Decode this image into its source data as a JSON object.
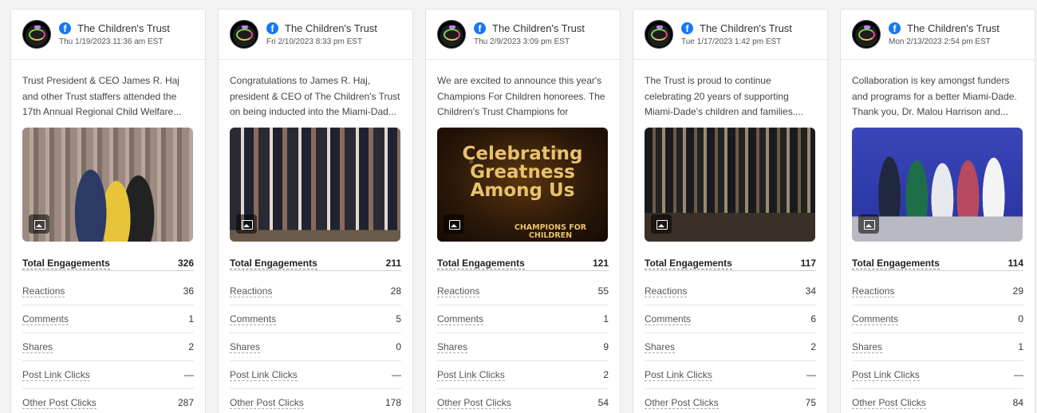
{
  "stat_labels": {
    "total": "Total Engagements",
    "reactions": "Reactions",
    "comments": "Comments",
    "shares": "Shares",
    "link_clicks": "Post Link Clicks",
    "other_clicks": "Other Post Clicks"
  },
  "posts": [
    {
      "account": "The Children's Trust",
      "network_icon": "facebook-icon",
      "date": "Thu 1/19/2023 11:36 am EST",
      "text": "Trust President & CEO James R. Haj and other Trust staffers attended the 17th Annual Regional Child Welfare...",
      "total": "326",
      "reactions": "36",
      "comments": "1",
      "shares": "2",
      "link_clicks": "—",
      "other_clicks": "287"
    },
    {
      "account": "The Children's Trust",
      "network_icon": "facebook-icon",
      "date": "Fri 2/10/2023 8:33 pm EST",
      "text": "Congratulations to James R. Haj, president & CEO of The Children's Trust on being inducted into the Miami-Dad...",
      "total": "211",
      "reactions": "28",
      "comments": "5",
      "shares": "0",
      "link_clicks": "—",
      "other_clicks": "178"
    },
    {
      "account": "The Children's Trust",
      "network_icon": "facebook-icon",
      "date": "Thu 2/9/2023 3:09 pm EST",
      "text": "We are excited to announce this year's Champions For Children honorees. The Children's Trust Champions for Childre...",
      "image_text": "Celebrating Greatness Among Us",
      "image_sub": "CHAMPIONS FOR CHILDREN",
      "total": "121",
      "reactions": "55",
      "comments": "1",
      "shares": "9",
      "link_clicks": "2",
      "other_clicks": "54"
    },
    {
      "account": "The Children's Trust",
      "network_icon": "facebook-icon",
      "date": "Tue 1/17/2023 1:42 pm EST",
      "text": "The Trust is proud to continue celebrating 20 years of supporting Miami-Dade's children and families....",
      "total": "117",
      "reactions": "34",
      "comments": "6",
      "shares": "2",
      "link_clicks": "—",
      "other_clicks": "75"
    },
    {
      "account": "The Children's Trust",
      "network_icon": "facebook-icon",
      "date": "Mon 2/13/2023 2:54 pm EST",
      "text": "Collaboration is key amongst funders and programs for a better Miami-Dade. Thank you, Dr. Malou Harrison and...",
      "total": "114",
      "reactions": "29",
      "comments": "0",
      "shares": "1",
      "link_clicks": "—",
      "other_clicks": "84"
    }
  ]
}
